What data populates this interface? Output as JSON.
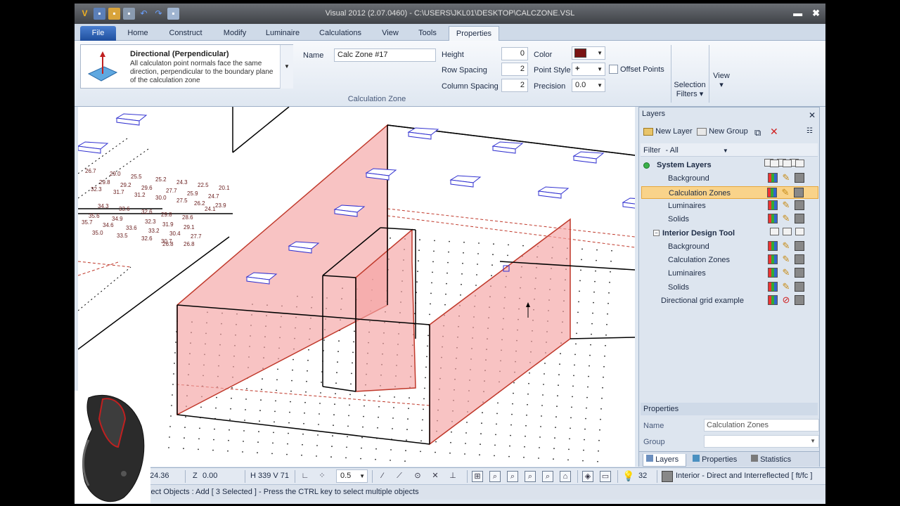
{
  "window": {
    "title": "Visual 2012 (2.07.0460) - C:\\USERS\\JKL01\\DESKTOP\\CALCZONE.VSL",
    "minimize": "▬",
    "close": "✖"
  },
  "tabs": [
    "File",
    "Home",
    "Construct",
    "Modify",
    "Luminaire",
    "Calculations",
    "View",
    "Tools",
    "Properties"
  ],
  "ribbon": {
    "direction_title": "Directional (Perpendicular)",
    "direction_desc": "All calculaton point normals face the same direction, perpendicular to the boundary plane of the calculation zone",
    "name_label": "Name",
    "name_value": "Calc Zone #17",
    "height_label": "Height",
    "height_value": "0",
    "row_spacing_label": "Row Spacing",
    "row_spacing_value": "2",
    "column_spacing_label": "Column Spacing",
    "column_spacing_value": "2",
    "color_label": "Color",
    "color_value": "#7a1414",
    "point_style_label": "Point Style",
    "point_style_value": "+",
    "precision_label": "Precision",
    "precision_value": "0.0",
    "offset_points_label": "Offset Points",
    "group_label": "Calculation Zone",
    "selection_filters_label": "Selection\nFilters",
    "view_label": "View"
  },
  "layers_panel": {
    "title": "Layers",
    "close": "✕",
    "new_layer": "New Layer",
    "new_group": "New Group",
    "filter_label": "Filter",
    "filter_value": "- All",
    "rows": [
      {
        "label": "System Layers",
        "level": 0,
        "bold": true,
        "status": "green"
      },
      {
        "label": "Background",
        "level": 1
      },
      {
        "label": "Calculation Zones",
        "level": 1,
        "selected": true
      },
      {
        "label": "Luminaires",
        "level": 1
      },
      {
        "label": "Solids",
        "level": 1
      },
      {
        "label": "Interior Design Tool",
        "level": 0,
        "bold": true,
        "status": "minus"
      },
      {
        "label": "Background",
        "level": 1
      },
      {
        "label": "Calculation Zones",
        "level": 1
      },
      {
        "label": "Luminaires",
        "level": 1
      },
      {
        "label": "Solids",
        "level": 1
      },
      {
        "label": "Directional grid example",
        "level": 0,
        "noCalc": true
      }
    ]
  },
  "properties_panel": {
    "title": "Properties",
    "name_label": "Name",
    "name_value": "Calculation Zones",
    "group_label": "Group",
    "group_value": ""
  },
  "panel_tabs": [
    "Layers",
    "Properties",
    "Statistics"
  ],
  "statusbar": {
    "x_value": "24.36",
    "z_label": "Z",
    "z_value": "0.00",
    "hv": "H 339  V 71",
    "snap_value": "0.5",
    "lamp_count": "32",
    "mode": "Interior - Direct and Interreflected [ ft/fc ]",
    "message": "elect Objects : Add [ 3  Selected ] - Press the CTRL key to select multiple objects"
  },
  "canvas_labels": [
    "26.7",
    "29.0",
    "25.5",
    "25.2",
    "24.3",
    "22.5",
    "20.1",
    "29.8",
    "29.2",
    "29.6",
    "27.7",
    "25.9",
    "24.7",
    "32.3",
    "31.7",
    "31.2",
    "30.0",
    "27.5",
    "26.2",
    "23.9",
    "34.3",
    "33.6",
    "32.6",
    "29.8",
    "28.6",
    "24.1",
    "35.6",
    "34.9",
    "32.3",
    "31.9",
    "29.1",
    "35.7",
    "34.6",
    "33.6",
    "33.2",
    "30.4",
    "27.7",
    "35.0",
    "33.5",
    "32.6",
    "30.7",
    "26.8",
    "26.8"
  ]
}
